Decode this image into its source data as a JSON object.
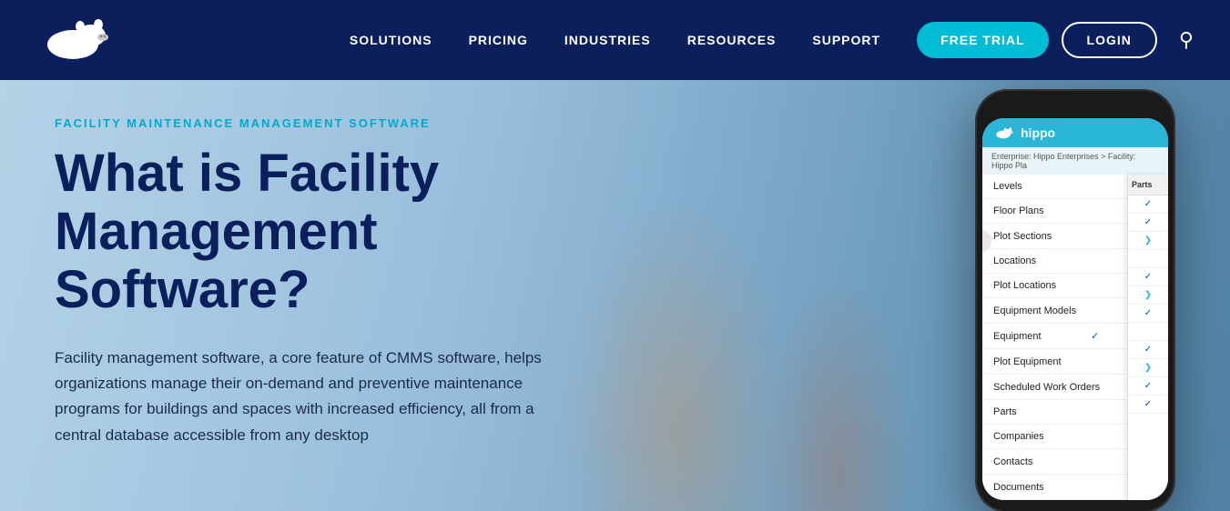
{
  "navbar": {
    "logo_alt": "Hippo CMMS",
    "links": [
      {
        "label": "SOLUTIONS",
        "id": "solutions"
      },
      {
        "label": "PRICING",
        "id": "pricing"
      },
      {
        "label": "INDUSTRIES",
        "id": "industries"
      },
      {
        "label": "RESOURCES",
        "id": "resources"
      },
      {
        "label": "SUPPORT",
        "id": "support"
      }
    ],
    "free_trial_label": "FREE TRIAL",
    "login_label": "LOGIN"
  },
  "hero": {
    "subtitle": "FACILITY MAINTENANCE MANAGEMENT SOFTWARE",
    "title_line1": "What is Facility",
    "title_line2": "Management",
    "title_line3": "Software?",
    "description": "Facility management software, a core feature of CMMS software, helps organizations manage their on-demand and preventive maintenance programs for buildings and spaces with increased efficiency, all from a central database accessible from any desktop"
  },
  "phone": {
    "app_name": "hippo",
    "breadcrumb_enterprise": "Enterprise: Hippo Enterprises",
    "breadcrumb_separator": ">",
    "breadcrumb_facility": "Facility: Hippo Pla",
    "menu_items": [
      {
        "label": "Levels",
        "check": false,
        "arrow": false
      },
      {
        "label": "Floor Plans",
        "check": false,
        "arrow": false
      },
      {
        "label": "Plot Sections",
        "check": true,
        "arrow": false
      },
      {
        "label": "Locations",
        "check": false,
        "arrow": false
      },
      {
        "label": "Plot Locations",
        "check": false,
        "arrow": false
      },
      {
        "label": "Equipment Models",
        "check": true,
        "arrow": false
      },
      {
        "label": "Equipment",
        "check": true,
        "arrow": true
      },
      {
        "label": "Plot Equipment",
        "check": false,
        "arrow": true
      },
      {
        "label": "Scheduled Work Orders",
        "check": true,
        "arrow": false
      },
      {
        "label": "Parts",
        "check": false,
        "arrow": false
      },
      {
        "label": "Companies",
        "check": false,
        "arrow": false
      },
      {
        "label": "Contacts",
        "check": true,
        "arrow": false
      },
      {
        "label": "Documents",
        "check": true,
        "arrow": false
      }
    ],
    "side_panel_title": "Parts"
  },
  "colors": {
    "nav_bg": "#0a1f5c",
    "accent_cyan": "#29b6d8",
    "title_blue": "#0a1f5c",
    "subtitle_cyan": "#00aacc",
    "free_trial_bg": "#00bcd4"
  }
}
